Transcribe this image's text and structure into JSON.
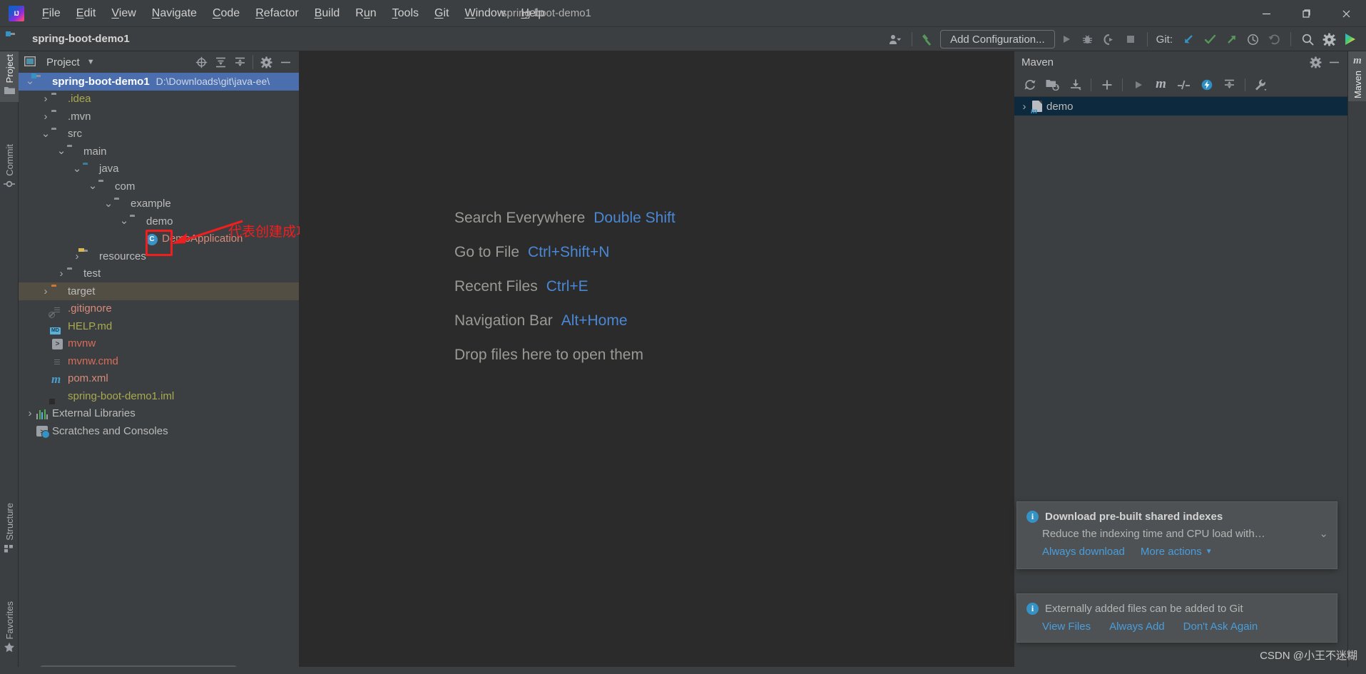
{
  "window": {
    "title": "spring-boot-demo1",
    "minimize_label": "─",
    "maximize_label": "❐",
    "close_label": "✕",
    "logo_icon": "intellij-idea-logo"
  },
  "menubar": {
    "items": [
      {
        "label": "File",
        "mnemonic": "F"
      },
      {
        "label": "Edit",
        "mnemonic": "E"
      },
      {
        "label": "View",
        "mnemonic": "V"
      },
      {
        "label": "Navigate",
        "mnemonic": "N"
      },
      {
        "label": "Code",
        "mnemonic": "C"
      },
      {
        "label": "Refactor",
        "mnemonic": "R"
      },
      {
        "label": "Build",
        "mnemonic": "B"
      },
      {
        "label": "Run",
        "mnemonic": "u"
      },
      {
        "label": "Tools",
        "mnemonic": "T"
      },
      {
        "label": "Git",
        "mnemonic": "G"
      },
      {
        "label": "Window",
        "mnemonic": "W"
      },
      {
        "label": "Help",
        "mnemonic": "H"
      }
    ]
  },
  "navbar": {
    "project_name": "spring-boot-demo1",
    "project_icon": "project-folder-icon"
  },
  "toolbar": {
    "profiler_icon": "user-profiler-icon",
    "build_icon": "build-hammer-icon",
    "add_configuration_label": "Add Configuration...",
    "run_icon": "run-icon",
    "debug_icon": "debug-bug-icon",
    "run_coverage_icon": "run-with-coverage-icon",
    "stop_icon": "stop-icon",
    "git_label": "Git:",
    "git_update_icon": "git-update-project-icon",
    "git_commit_icon": "git-commit-icon",
    "git_push_icon": "git-push-icon",
    "git_history_icon": "git-history-icon",
    "git_rollback_icon": "git-rollback-icon",
    "search_icon": "search-everywhere-icon",
    "settings_icon": "settings-gear-icon",
    "ide_logo_icon": "ide-feature-trainer-icon",
    "accent_blue": "#4a88d6",
    "accent_green": "#57965c"
  },
  "left_strip": {
    "items": [
      {
        "label": "Project",
        "icon": "project-folder-icon",
        "active": true
      },
      {
        "label": "Commit",
        "icon": "commit-node-icon",
        "active": false
      }
    ],
    "bottom_items": [
      {
        "label": "Structure",
        "icon": "structure-squares-icon",
        "active": false
      },
      {
        "label": "Favorites",
        "icon": "favorites-star-icon",
        "active": false
      }
    ]
  },
  "right_strip": {
    "items": [
      {
        "label": "Maven",
        "icon": "maven-m-icon",
        "active": true
      }
    ]
  },
  "project_panel": {
    "title": "Project",
    "dropdown_icon": "chevron-down-icon",
    "tools": [
      {
        "name": "select-opened-file-icon",
        "glyph": "⊕"
      },
      {
        "name": "expand-all-icon",
        "glyph": "expand"
      },
      {
        "name": "collapse-all-icon",
        "glyph": "collapse"
      },
      {
        "name": "settings-gear-icon",
        "glyph": "gear"
      },
      {
        "name": "hide-icon",
        "glyph": "─"
      }
    ],
    "tree": [
      {
        "label": "spring-boot-demo1",
        "sub": "D:\\Downloads\\git\\java-ee\\",
        "depth": 0,
        "twisty": "down",
        "icon": "project-folder-icon",
        "state": "selected",
        "bold": true,
        "color": "#ffffff"
      },
      {
        "label": ".idea",
        "depth": 1,
        "twisty": "right",
        "icon": "folder-grey-icon",
        "color": "#a9a950"
      },
      {
        "label": ".mvn",
        "depth": 1,
        "twisty": "right",
        "icon": "folder-grey-icon",
        "color": "#bbbbbb"
      },
      {
        "label": "src",
        "depth": 1,
        "twisty": "down",
        "icon": "folder-grey-icon",
        "color": "#bbbbbb"
      },
      {
        "label": "main",
        "depth": 2,
        "twisty": "down",
        "icon": "folder-grey-icon",
        "color": "#bbbbbb"
      },
      {
        "label": "java",
        "depth": 3,
        "twisty": "down",
        "icon": "folder-source-root-icon",
        "color": "#bbbbbb"
      },
      {
        "label": "com",
        "depth": 4,
        "twisty": "down",
        "icon": "package-icon",
        "color": "#bbbbbb"
      },
      {
        "label": "example",
        "depth": 5,
        "twisty": "down",
        "icon": "package-icon",
        "color": "#bbbbbb"
      },
      {
        "label": "demo",
        "depth": 6,
        "twisty": "down",
        "icon": "package-icon",
        "color": "#bbbbbb"
      },
      {
        "label": "DemoApplication",
        "depth": 7,
        "twisty": "none",
        "icon": "java-class-icon",
        "color": "#d88a7a"
      },
      {
        "label": "resources",
        "depth": 3,
        "twisty": "right",
        "icon": "folder-resources-icon",
        "color": "#bbbbbb"
      },
      {
        "label": "test",
        "depth": 2,
        "twisty": "right",
        "icon": "folder-grey-icon",
        "color": "#bbbbbb"
      },
      {
        "label": "target",
        "depth": 1,
        "twisty": "right",
        "icon": "folder-excluded-icon",
        "state": "excluded",
        "color": "#bbbbbb"
      },
      {
        "label": ".gitignore",
        "depth": 1,
        "twisty": "none",
        "icon": "gitignore-file-icon",
        "color": "#d88a7a"
      },
      {
        "label": "HELP.md",
        "depth": 1,
        "twisty": "none",
        "icon": "markdown-file-icon",
        "color": "#a9a950"
      },
      {
        "label": "mvnw",
        "depth": 1,
        "twisty": "none",
        "icon": "shell-script-icon",
        "color": "#d86c5a"
      },
      {
        "label": "mvnw.cmd",
        "depth": 1,
        "twisty": "none",
        "icon": "cmd-file-icon",
        "color": "#d86c5a"
      },
      {
        "label": "pom.xml",
        "depth": 1,
        "twisty": "none",
        "icon": "maven-pom-icon",
        "color": "#d88a7a"
      },
      {
        "label": "spring-boot-demo1.iml",
        "depth": 1,
        "twisty": "none",
        "icon": "iml-module-file-icon",
        "color": "#a9a950"
      },
      {
        "label": "External Libraries",
        "depth": 0,
        "twisty": "right",
        "icon": "external-libraries-icon",
        "color": "#bbbbbb"
      },
      {
        "label": "Scratches and Consoles",
        "depth": 0,
        "twisty": "none",
        "icon": "scratches-icon",
        "color": "#bbbbbb"
      }
    ]
  },
  "annotation": {
    "text": "代表创建成功",
    "color": "#ef1f1f",
    "target": "java-class-icon of DemoApplication"
  },
  "editor": {
    "welcome_rows": [
      {
        "action": "Search Everywhere",
        "key": "Double Shift"
      },
      {
        "action": "Go to File",
        "key": "Ctrl+Shift+N"
      },
      {
        "action": "Recent Files",
        "key": "Ctrl+E"
      },
      {
        "action": "Navigation Bar",
        "key": "Alt+Home"
      },
      {
        "action": "Drop files here to open them",
        "key": ""
      }
    ]
  },
  "maven_panel": {
    "title": "Maven",
    "header_tools": [
      {
        "name": "settings-gear-icon"
      },
      {
        "name": "hide-icon"
      }
    ],
    "toolbar": [
      {
        "name": "reload-all-maven-projects-icon"
      },
      {
        "name": "add-maven-project-icon"
      },
      {
        "name": "download-sources-icon"
      },
      {
        "name": "add-icon"
      },
      {
        "name": "run-icon"
      },
      {
        "name": "execute-maven-goal-icon"
      },
      {
        "name": "toggle-skip-tests-icon"
      },
      {
        "name": "toggle-offline-mode-icon"
      },
      {
        "name": "collapse-all-icon"
      },
      {
        "name": "maven-settings-wrench-icon"
      }
    ],
    "tree": [
      {
        "label": "demo",
        "twisty": "right",
        "icon": "maven-project-icon",
        "selected": true
      }
    ]
  },
  "notifications": [
    {
      "icon": "info-icon",
      "title": "Download pre-built shared indexes",
      "description": "Reduce the indexing time and CPU load with…",
      "expand_icon": "chevron-down-icon",
      "links": [
        "Always download",
        "More actions"
      ],
      "has_more_dropdown": true
    },
    {
      "icon": "info-icon",
      "title": "Externally added files can be added to Git",
      "description": "",
      "links": [
        "View Files",
        "Always Add",
        "Don't Ask Again"
      ],
      "has_more_dropdown": false
    }
  ],
  "watermark": "CSDN @小王不迷糊"
}
